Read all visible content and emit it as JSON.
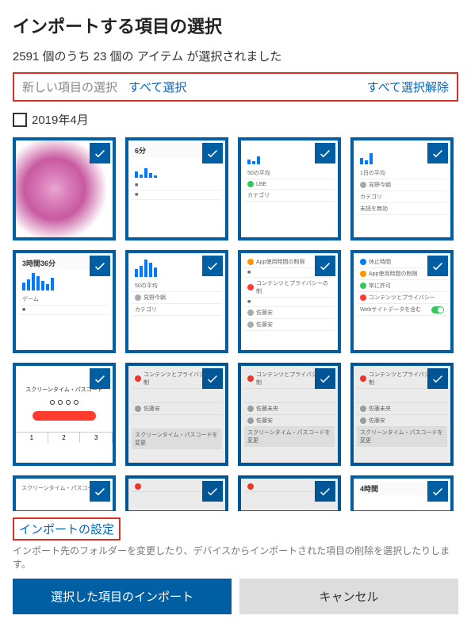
{
  "header": {
    "title": "インポートする項目の選択",
    "subtitle": "2591 個のうち 23 個の アイテム が選択されました"
  },
  "selectionBar": {
    "label": "新しい項目の選択",
    "selectAll": "すべて選択",
    "deselectAll": "すべて選択解除"
  },
  "section": {
    "title": "2019年4月"
  },
  "thumbs": {
    "t2": "6分",
    "t5": "3時間36分",
    "t13": "4時間"
  },
  "footer": {
    "settingsLink": "インポートの設定",
    "help": "インポート先のフォルダーを変更したり、デバイスからインポートされた項目の削除を選択したりします。",
    "importBtn": "選択した項目のインポート",
    "cancelBtn": "キャンセル"
  }
}
